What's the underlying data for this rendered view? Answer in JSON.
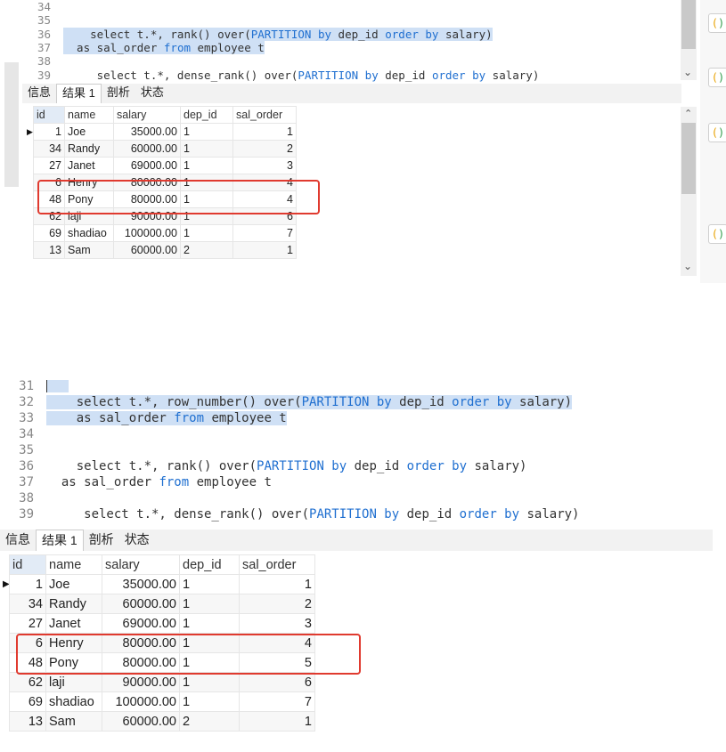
{
  "top": {
    "lines": [
      {
        "n": "34",
        "text": ""
      },
      {
        "n": "35",
        "text": ""
      },
      {
        "n": "36",
        "pre": "    select t.*, rank() over(",
        "kw1": "PARTITION by",
        "mid": " dep_id ",
        "kw2": "order by",
        "post": " salary)"
      },
      {
        "n": "37",
        "pre": "  as sal_order ",
        "kw1": "from",
        "mid": " employee t",
        "kw2": "",
        "post": ""
      },
      {
        "n": "38",
        "text": ""
      },
      {
        "n": "39",
        "pre": "     select t.*, dense_rank() over(",
        "kw1": "PARTITION by",
        "mid": " dep_id ",
        "kw2": "order by",
        "post": " salary)"
      }
    ],
    "tabs": [
      "信息",
      "结果 1",
      "剖析",
      "状态"
    ],
    "headers": [
      "id",
      "name",
      "salary",
      "dep_id",
      "sal_order"
    ],
    "rows": [
      [
        "1",
        "Joe",
        "35000.00",
        "1",
        "1"
      ],
      [
        "34",
        "Randy",
        "60000.00",
        "1",
        "2"
      ],
      [
        "27",
        "Janet",
        "69000.00",
        "1",
        "3"
      ],
      [
        "6",
        "Henry",
        "80000.00",
        "1",
        "4"
      ],
      [
        "48",
        "Pony",
        "80000.00",
        "1",
        "4"
      ],
      [
        "62",
        "laji",
        "90000.00",
        "1",
        "6"
      ],
      [
        "69",
        "shadiao",
        "100000.00",
        "1",
        "7"
      ],
      [
        "13",
        "Sam",
        "60000.00",
        "2",
        "1"
      ]
    ]
  },
  "bottom": {
    "lines": [
      {
        "n": "31",
        "text": ""
      },
      {
        "n": "32",
        "pre": "    select t.*, row_number() over(",
        "kw1": "PARTITION by",
        "mid": " dep_id ",
        "kw2": "order by",
        "post": " salary)"
      },
      {
        "n": "33",
        "pre": "    as sal_order ",
        "kw1": "from",
        "mid": " employee t",
        "kw2": "",
        "post": ""
      },
      {
        "n": "34",
        "text": ""
      },
      {
        "n": "35",
        "text": ""
      },
      {
        "n": "36",
        "pre": "    select t.*, rank() over(",
        "kw1": "PARTITION by",
        "mid": " dep_id ",
        "kw2": "order by",
        "post": " salary)"
      },
      {
        "n": "37",
        "pre": "  as sal_order ",
        "kw1": "from",
        "mid": " employee t",
        "kw2": "",
        "post": ""
      },
      {
        "n": "38",
        "text": ""
      },
      {
        "n": "39",
        "pre": "     select t.*, dense_rank() over(",
        "kw1": "PARTITION by",
        "mid": " dep_id ",
        "kw2": "order by",
        "post": " salary)"
      }
    ],
    "tabs": [
      "信息",
      "结果 1",
      "剖析",
      "状态"
    ],
    "headers": [
      "id",
      "name",
      "salary",
      "dep_id",
      "sal_order"
    ],
    "rows": [
      [
        "1",
        "Joe",
        "35000.00",
        "1",
        "1"
      ],
      [
        "34",
        "Randy",
        "60000.00",
        "1",
        "2"
      ],
      [
        "27",
        "Janet",
        "69000.00",
        "1",
        "3"
      ],
      [
        "6",
        "Henry",
        "80000.00",
        "1",
        "4"
      ],
      [
        "48",
        "Pony",
        "80000.00",
        "1",
        "5"
      ],
      [
        "62",
        "laji",
        "90000.00",
        "1",
        "6"
      ],
      [
        "69",
        "shadiao",
        "100000.00",
        "1",
        "7"
      ],
      [
        "13",
        "Sam",
        "60000.00",
        "2",
        "1"
      ]
    ]
  },
  "colors": {
    "keyword": "#1f6fd0",
    "highlight": "#cfe0f5",
    "annotation": "#e03a2f"
  }
}
